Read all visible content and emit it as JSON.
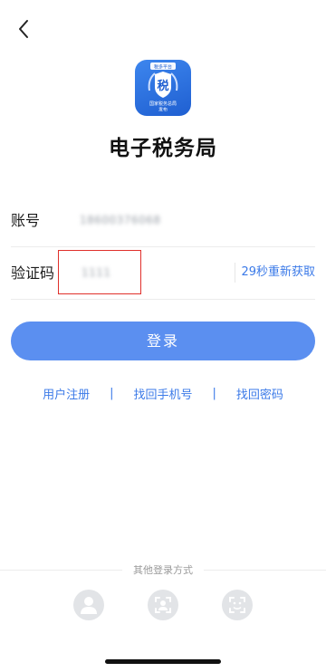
{
  "header": {
    "back_icon": "chevron-left-icon"
  },
  "logo": {
    "banner_text": "税多平台",
    "glyph": "税",
    "caption_line1": "国家税务总局",
    "caption_line2": "发布"
  },
  "app_title": "电子税务局",
  "form": {
    "account_label": "账号",
    "account_value": "18600376068",
    "code_label": "验证码",
    "code_value": "1111",
    "resend_label": "29秒重新获取"
  },
  "login_button": "登录",
  "links": {
    "register": "用户注册",
    "separator": "|",
    "recover_phone": "找回手机号",
    "recover_password": "找回密码"
  },
  "other_login": {
    "label": "其他登录方式",
    "options": [
      "user-icon",
      "face-scan-icon",
      "face-id-icon"
    ]
  },
  "colors": {
    "accent": "#3b7ae8",
    "button": "#5b8ff0",
    "highlight": "#e0302b"
  }
}
